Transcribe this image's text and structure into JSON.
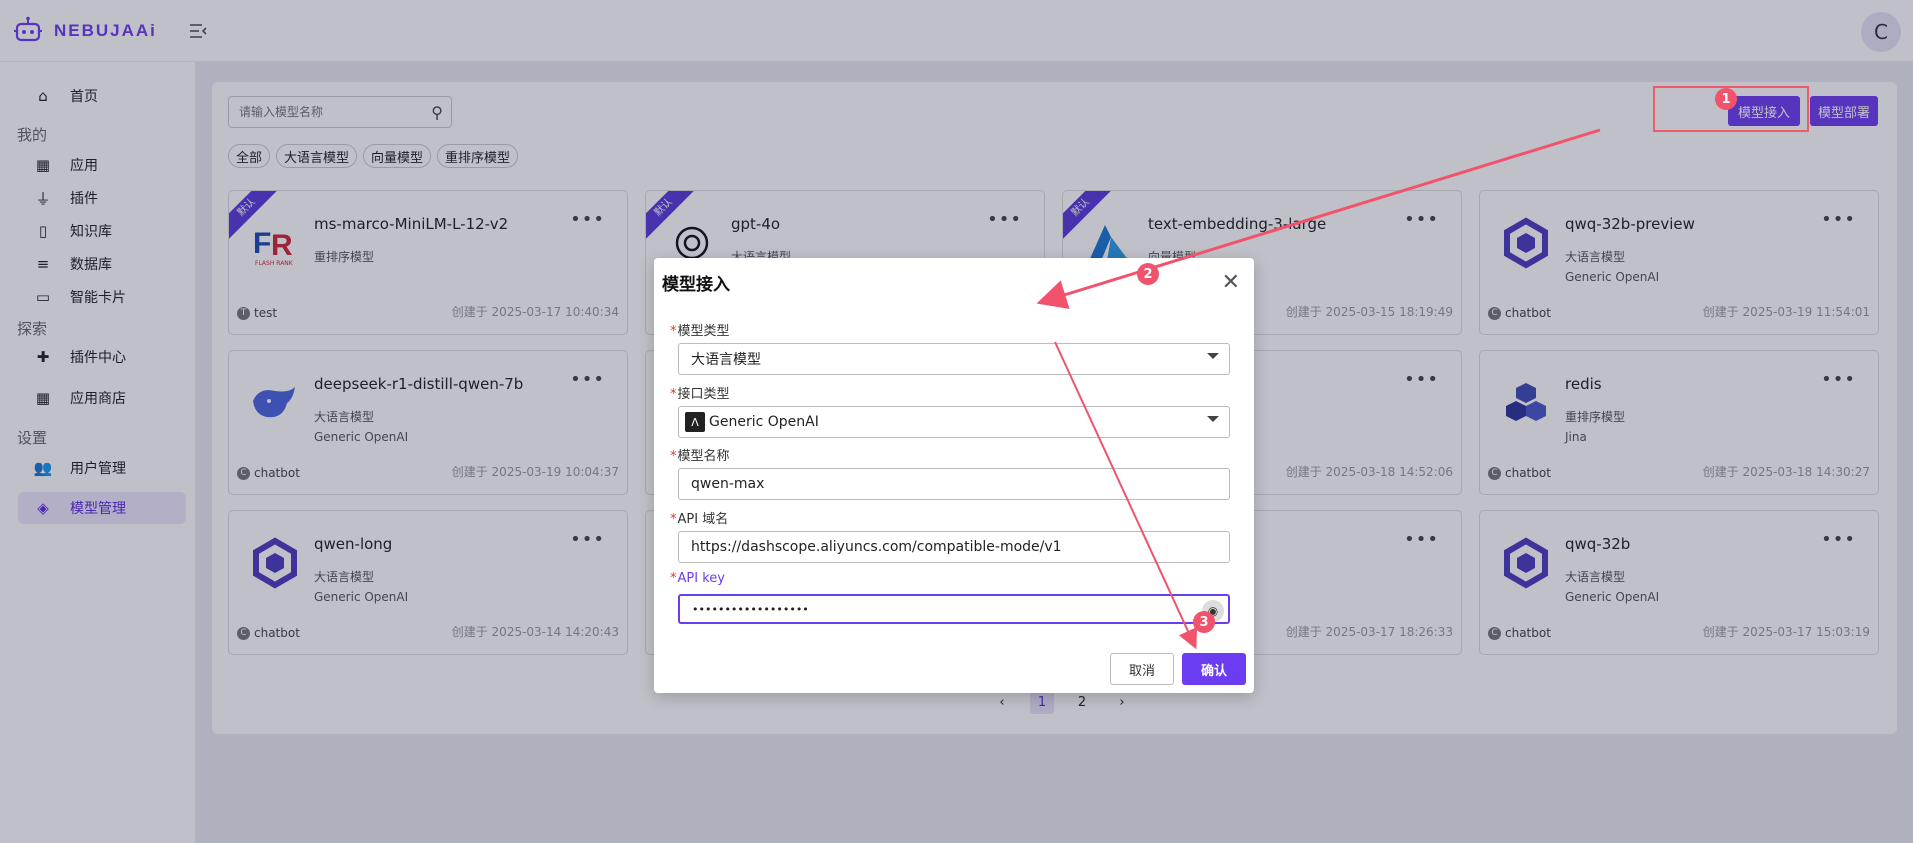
{
  "header": {
    "brand": "NEBUJAAi",
    "avatar_letter": "C"
  },
  "sidebar": {
    "home": "首页",
    "section_mine": "我的",
    "items_mine": [
      "应用",
      "插件",
      "知识库",
      "数据库",
      "智能卡片"
    ],
    "section_explore": "探索",
    "items_explore": [
      "插件中心",
      "应用商店"
    ],
    "section_settings": "设置",
    "items_settings": [
      "用户管理",
      "模型管理"
    ]
  },
  "search": {
    "placeholder": "请输入模型名称"
  },
  "filters": [
    "全部",
    "大语言模型",
    "向量模型",
    "重排序模型"
  ],
  "top_buttons": {
    "access": "模型接入",
    "deploy": "模型部署"
  },
  "cards": [
    {
      "name": "ms-marco-MiniLM-L-12-v2",
      "type": "重排序模型",
      "provider": "",
      "owner": "test",
      "owner_initial": "T",
      "date": "创建于 2025-03-17 10:40:34",
      "ribbon": "默认"
    },
    {
      "name": "gpt-4o",
      "type": "大语言模型",
      "provider": "",
      "owner": "",
      "owner_initial": "",
      "date": "",
      "ribbon": "默认"
    },
    {
      "name": "text-embedding-3-large",
      "type": "向量模型",
      "provider": "",
      "owner": "",
      "owner_initial": "",
      "date": "创建于 2025-03-15 18:19:49",
      "ribbon": "默认"
    },
    {
      "name": "qwq-32b-preview",
      "type": "大语言模型",
      "provider": "Generic OpenAI",
      "owner": "chatbot",
      "owner_initial": "C",
      "date": "创建于 2025-03-19 11:54:01",
      "ribbon": ""
    },
    {
      "name": "deepseek-r1-distill-qwen-7b",
      "type": "大语言模型",
      "provider": "Generic OpenAI",
      "owner": "chatbot",
      "owner_initial": "C",
      "date": "创建于 2025-03-19 10:04:37",
      "ribbon": ""
    },
    {
      "name": "",
      "type": "",
      "provider": "",
      "owner": "",
      "owner_initial": "",
      "date": "",
      "ribbon": ""
    },
    {
      "name": "",
      "type": "",
      "provider": "",
      "owner": "",
      "owner_initial": "",
      "date": "创建于 2025-03-18 14:52:06",
      "ribbon": ""
    },
    {
      "name": "redis",
      "type": "重排序模型",
      "provider": "Jina",
      "owner": "chatbot",
      "owner_initial": "C",
      "date": "创建于 2025-03-18 14:30:27",
      "ribbon": ""
    },
    {
      "name": "qwen-long",
      "type": "大语言模型",
      "provider": "Generic OpenAI",
      "owner": "chatbot",
      "owner_initial": "C",
      "date": "创建于 2025-03-14 14:20:43",
      "ribbon": ""
    },
    {
      "name": "",
      "type": "",
      "provider": "",
      "owner": "",
      "owner_initial": "",
      "date": "",
      "ribbon": ""
    },
    {
      "name": "",
      "type": "",
      "provider": "",
      "owner": "",
      "owner_initial": "",
      "date": "创建于 2025-03-17 18:26:33",
      "ribbon": ""
    },
    {
      "name": "qwq-32b",
      "type": "大语言模型",
      "provider": "Generic OpenAI",
      "owner": "chatbot",
      "owner_initial": "C",
      "date": "创建于 2025-03-17 15:03:19",
      "ribbon": ""
    }
  ],
  "pager": {
    "prev": "‹",
    "pages": [
      "1",
      "2"
    ],
    "next": "›"
  },
  "modal": {
    "title": "模型接入",
    "model_type_label": "模型类型",
    "model_type_value": "大语言模型",
    "interface_type_label": "接口类型",
    "interface_type_value": "Generic OpenAI",
    "model_name_label": "模型名称",
    "model_name_value": "qwen-max",
    "api_domain_label": "API 域名",
    "api_domain_value": "https://dashscope.aliyuncs.com/compatible-mode/v1",
    "api_key_label": "API key",
    "api_key_value": "••••••••••••••••••",
    "cancel": "取消",
    "confirm": "确认"
  },
  "annotations": {
    "step1": "1",
    "step2": "2",
    "step3": "3"
  },
  "colors": {
    "accent": "#6c3df0",
    "annotation": "#f0536b"
  }
}
